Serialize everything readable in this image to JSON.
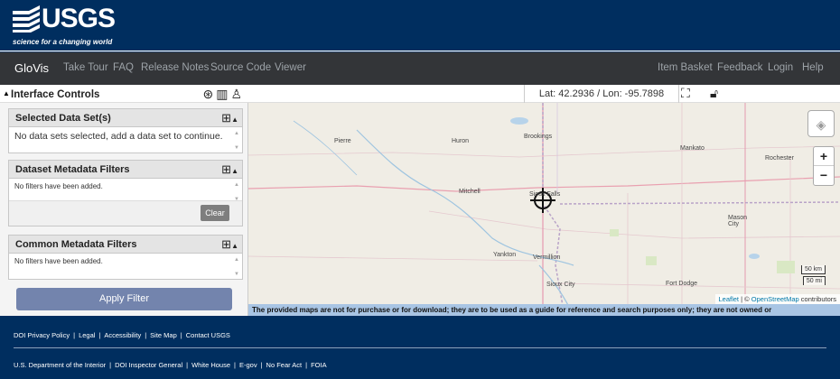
{
  "header": {
    "logo_text": "USGS",
    "tagline": "science for a changing world"
  },
  "nav": {
    "brand": "GloVis",
    "left": [
      "Take Tour",
      "FAQ",
      "Release Notes",
      "Source Code",
      "Viewer"
    ],
    "right": [
      "Item Basket",
      "Feedback",
      "Login",
      "Help"
    ]
  },
  "controls": {
    "title": "Interface Controls",
    "icons": [
      "steering-wheel-icon",
      "chart-icon",
      "user-settings-icon"
    ]
  },
  "coordinates": {
    "text": "Lat: 42.2936 / Lon: -95.7898"
  },
  "panels": {
    "selected": {
      "title": "Selected Data Set(s)",
      "message": "No data sets selected, add a data set to continue."
    },
    "dataset_filters": {
      "title": "Dataset Metadata Filters",
      "message": "No filters have been added.",
      "clear": "Clear"
    },
    "common_filters": {
      "title": "Common Metadata Filters",
      "message": "No filters have been added."
    }
  },
  "apply_filter": "Apply Filter",
  "map": {
    "cities": [
      "Pierre",
      "Huron",
      "Brookings",
      "Mankato",
      "Rochester",
      "Mitchell",
      "Sioux Falls",
      "Mason City",
      "Yankton",
      "Vermillion",
      "Sioux City",
      "Fort Dodge"
    ],
    "zoom_in": "+",
    "zoom_out": "−",
    "scale_km": "50 km",
    "scale_mi": "50 mi",
    "attribution_leaflet": "Leaflet",
    "attribution_mid": " | © ",
    "attribution_osm": "OpenStreetMap",
    "attribution_end": " contributors"
  },
  "disclaimer": "The provided maps are not for purchase or for download; they are to be used as a guide for reference and search purposes only; they are not owned or",
  "footer": {
    "row1": [
      "DOI Privacy Policy",
      "Legal",
      "Accessibility",
      "Site Map",
      "Contact USGS"
    ],
    "row2": [
      "U.S. Department of the Interior",
      "DOI Inspector General",
      "White House",
      "E-gov",
      "No Fear Act",
      "FOIA"
    ]
  },
  "colors": {
    "banner": "#002e5f",
    "navbar": "#333538",
    "apply_button": "#7384ad",
    "disclaimer_bg": "#a9c5e4"
  }
}
